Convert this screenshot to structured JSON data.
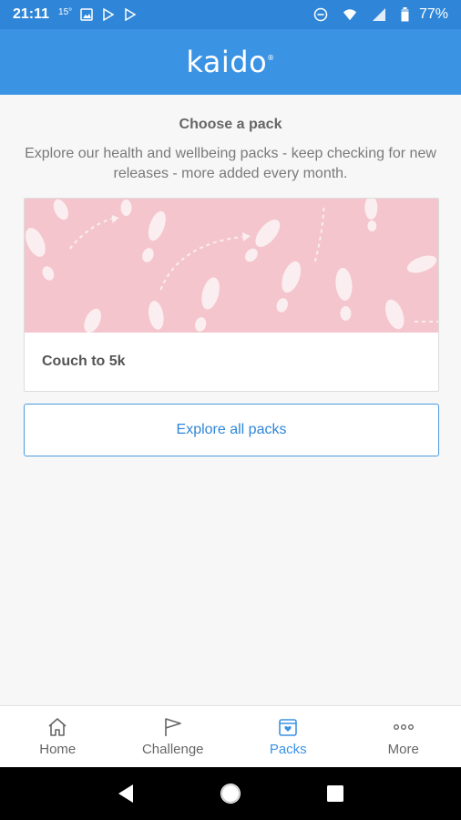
{
  "status_bar": {
    "time": "21:11",
    "temperature": "15°",
    "battery_percent": "77%",
    "icons": [
      "photo-icon",
      "play-store-icon",
      "play-store-icon",
      "do-not-disturb-icon",
      "wifi-icon",
      "signal-icon",
      "battery-icon"
    ]
  },
  "app_bar": {
    "logo_text": "kaido",
    "logo_mark": "®"
  },
  "main": {
    "title": "Choose a pack",
    "description": "Explore our health and wellbeing packs - keep checking for new releases - more added every month.",
    "packs": [
      {
        "label": "Couch to 5k",
        "image": "footprints-illustration"
      }
    ],
    "explore_button": "Explore all packs"
  },
  "tab_bar": {
    "tabs": [
      {
        "label": "Home",
        "icon": "home-icon",
        "active": false
      },
      {
        "label": "Challenge",
        "icon": "flag-icon",
        "active": false
      },
      {
        "label": "Packs",
        "icon": "pack-icon",
        "active": true
      },
      {
        "label": "More",
        "icon": "more-dots-icon",
        "active": false
      }
    ]
  },
  "nav_bar": {
    "buttons": [
      "back-icon",
      "home-circle-icon",
      "recents-icon"
    ]
  },
  "colors": {
    "primary": "#3b93e4",
    "status_bar": "#2f86d8",
    "pack_bg": "#f4c5cc",
    "text_muted": "#7a7a7a"
  }
}
